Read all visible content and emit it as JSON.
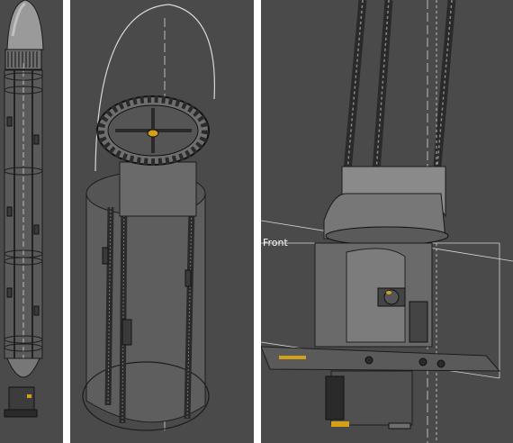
{
  "panels": [
    {
      "id": "overview-view"
    },
    {
      "id": "gear-closeup-view"
    },
    {
      "id": "assembly-closeup-view"
    }
  ],
  "plane_label": "Front",
  "colors": {
    "background": "#4a4a4a",
    "separator": "#ffffff",
    "edge": "#1c1c1c",
    "construction_line": "#d8d8d8",
    "highlight": "#d4a017"
  }
}
